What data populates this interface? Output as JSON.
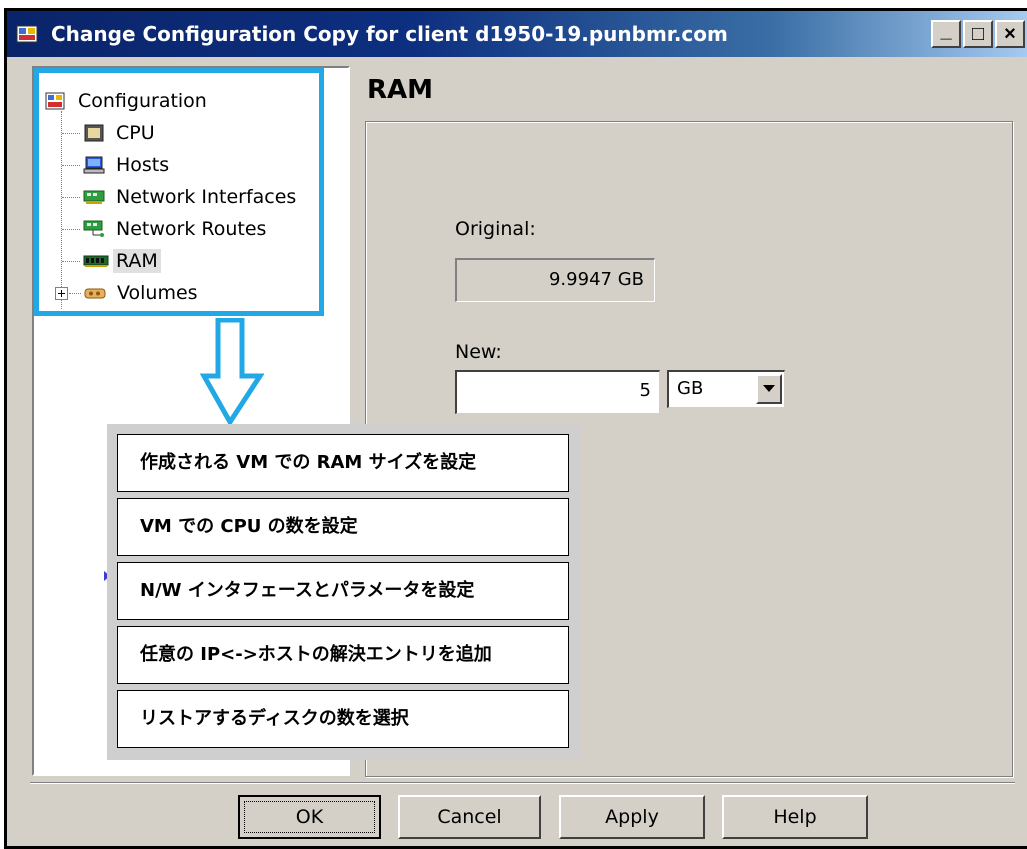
{
  "window": {
    "title": "Change Configuration Copy for client d1950-19.punbmr.com",
    "controls": [
      "_",
      "□",
      "×"
    ]
  },
  "tree": {
    "items": [
      {
        "label": "Configuration",
        "icon": "configuration-icon"
      },
      {
        "label": "CPU",
        "icon": "cpu-icon"
      },
      {
        "label": "Hosts",
        "icon": "hosts-icon"
      },
      {
        "label": "Network Interfaces",
        "icon": "network-interfaces-icon"
      },
      {
        "label": "Network Routes",
        "icon": "network-routes-icon"
      },
      {
        "label": "RAM",
        "icon": "ram-icon",
        "selected": true
      },
      {
        "label": "Volumes",
        "icon": "volumes-icon",
        "expandable": true
      }
    ]
  },
  "ram": {
    "title": "RAM",
    "original_label": "Original:",
    "original_value": "9.9947 GB",
    "new_label": "New:",
    "new_value": "5",
    "unit": "GB"
  },
  "callouts": [
    "作成される VM での RAM サイズを設定",
    "VM での CPU の数を設定",
    "N/W インタフェースとパラメータを設定",
    "任意の IP<->ホストの解決エントリを追加",
    "リストアするディスクの数を選択"
  ],
  "buttons": {
    "ok": "OK",
    "cancel": "Cancel",
    "apply": "Apply",
    "help": "Help"
  },
  "colors": {
    "highlight": "#22a8e4",
    "titlebar": "#0a246a",
    "dialog_bg": "#d4d0c8"
  }
}
